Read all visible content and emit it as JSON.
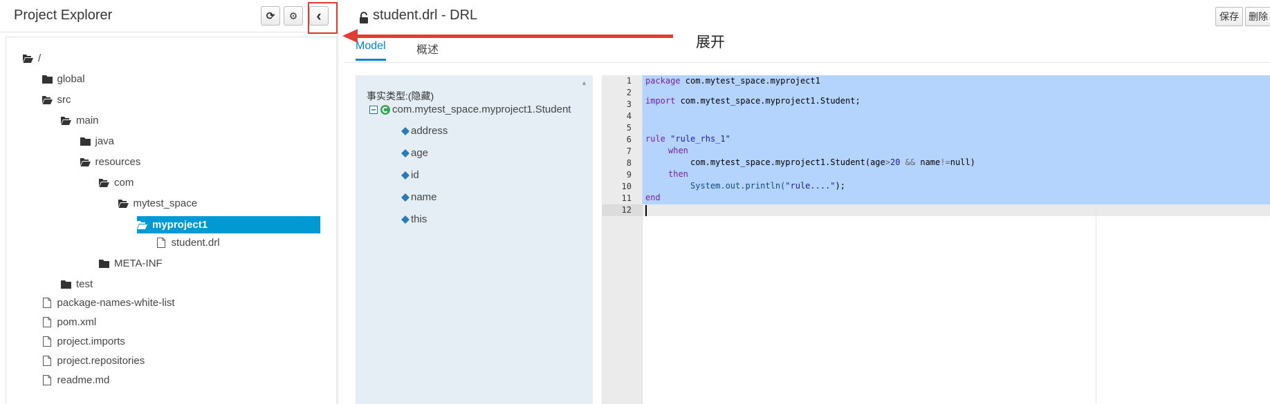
{
  "explorer": {
    "title": "Project Explorer",
    "buttons": [
      {
        "name": "refresh",
        "icon": "refresh-icon",
        "glyph": "⟳"
      },
      {
        "name": "settings",
        "icon": "gear-icon",
        "glyph": "⚙"
      },
      {
        "name": "collapse",
        "icon": "chevron-left-icon",
        "glyph": "‹"
      }
    ],
    "tree": [
      {
        "label": "/",
        "icon": "folder-open-icon",
        "depth": 0
      },
      {
        "label": "global",
        "icon": "folder-icon",
        "depth": 1
      },
      {
        "label": "src",
        "icon": "folder-open-icon",
        "depth": 1
      },
      {
        "label": "main",
        "icon": "folder-open-icon",
        "depth": 2
      },
      {
        "label": "java",
        "icon": "folder-icon",
        "depth": 3
      },
      {
        "label": "resources",
        "icon": "folder-open-icon",
        "depth": 3
      },
      {
        "label": "com",
        "icon": "folder-open-icon",
        "depth": 4
      },
      {
        "label": "mytest_space",
        "icon": "folder-open-icon",
        "depth": 5
      },
      {
        "label": "myproject1",
        "icon": "folder-open-icon",
        "depth": 6,
        "selected": true
      },
      {
        "label": "student.drl",
        "icon": "file-icon",
        "depth": 7
      },
      {
        "label": "META-INF",
        "icon": "folder-icon",
        "depth": 4
      },
      {
        "label": "test",
        "icon": "folder-icon",
        "depth": 2
      },
      {
        "label": "package-names-white-list",
        "icon": "file-icon",
        "depth": 1
      },
      {
        "label": "pom.xml",
        "icon": "file-icon",
        "depth": 1
      },
      {
        "label": "project.imports",
        "icon": "file-icon",
        "depth": 1
      },
      {
        "label": "project.repositories",
        "icon": "file-icon",
        "depth": 1
      },
      {
        "label": "readme.md",
        "icon": "file-icon",
        "depth": 1
      }
    ],
    "selected_color": "#0099d3"
  },
  "editor": {
    "title": "student.drl - DRL",
    "lock_icon": "lock-icon",
    "save_label": "保存",
    "delete_label": "删除",
    "tabs": [
      {
        "label": "Model",
        "active": true
      },
      {
        "label": "概述",
        "active": false
      }
    ],
    "facts": {
      "title": "事实类型:(隐藏)",
      "class_name": "com.mytest_space.myproject1.Student",
      "fields": [
        "address",
        "age",
        "id",
        "name",
        "this"
      ]
    },
    "code_lines": [
      {
        "n": "1"
      },
      {
        "n": "2"
      },
      {
        "n": "3"
      },
      {
        "n": "4"
      },
      {
        "n": "5"
      },
      {
        "n": "6"
      },
      {
        "n": "7"
      },
      {
        "n": "8"
      },
      {
        "n": "9"
      },
      {
        "n": "10"
      },
      {
        "n": "11"
      },
      {
        "n": "12"
      }
    ],
    "code": {
      "l1_kw": "package",
      "l1_rest": " com.mytest_space.myproject1",
      "l3_kw": "import",
      "l3_rest": " com.mytest_space.myproject1.Student;",
      "l6_kw": "rule",
      "l6_str": "\"rule_rhs_1\"",
      "l7_kw": "when",
      "l8_a": "com.mytest_space.myproject1.Student(age",
      "l8_op1": ">",
      "l8_num": "20",
      "l8_op2": " && ",
      "l8_b": "name",
      "l8_op3": "!=",
      "l8_c": "null)",
      "l9_kw": "then",
      "l10_fn": "System.out.println(",
      "l10_str": "\"rule....\"",
      "l10_end": ");",
      "l11_kw": "end"
    }
  },
  "annotation": {
    "label": "展开",
    "color": "#e43b37"
  }
}
